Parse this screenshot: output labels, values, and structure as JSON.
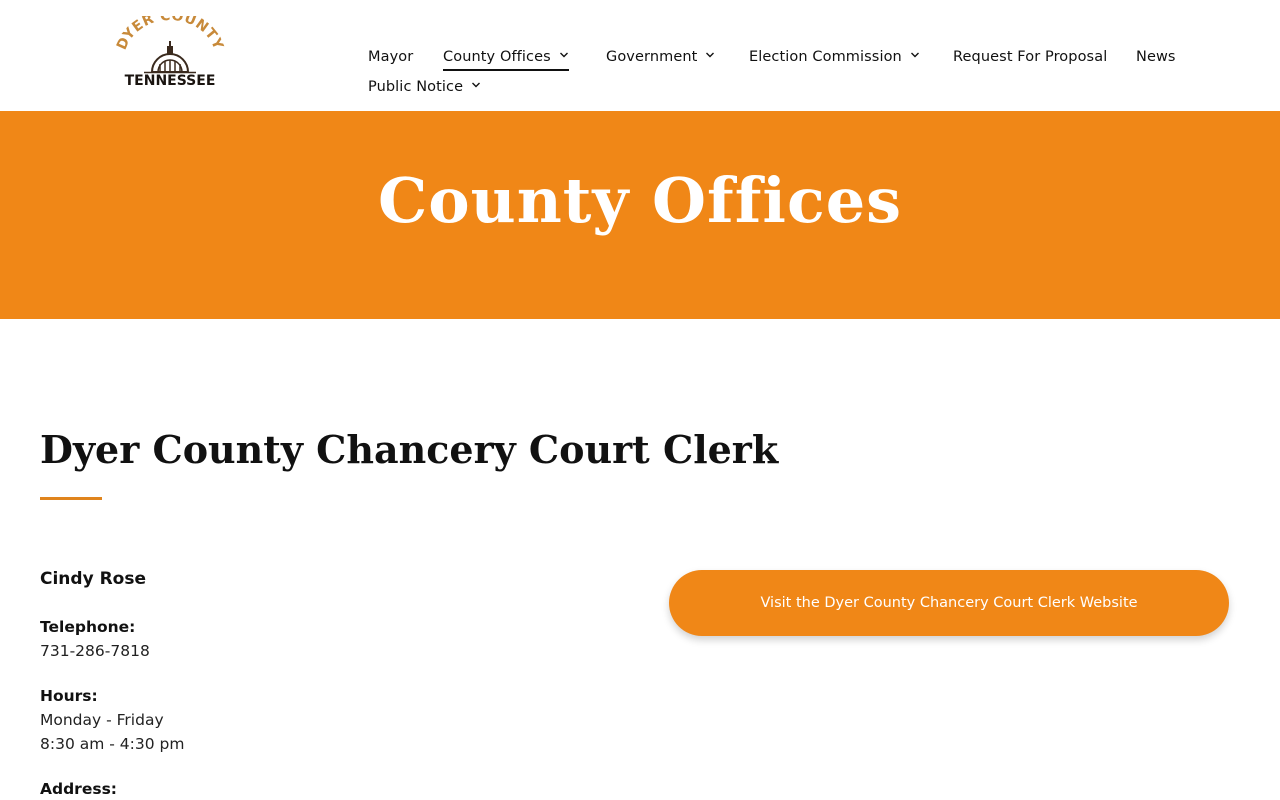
{
  "logo": {
    "arc_text": "DYER COUNTY",
    "sub_text": "TENNESSEE",
    "icon": "county-courthouse-logo"
  },
  "nav": {
    "items": [
      {
        "label": "Mayor",
        "has_dropdown": false
      },
      {
        "label": "County Offices",
        "has_dropdown": true,
        "active": true
      },
      {
        "label": "Government",
        "has_dropdown": true
      },
      {
        "label": "Election Commission",
        "has_dropdown": true
      },
      {
        "label": "Request For Proposal",
        "has_dropdown": false
      },
      {
        "label": "News",
        "has_dropdown": false
      },
      {
        "label": "Public Notice",
        "has_dropdown": true
      }
    ]
  },
  "banner": {
    "title": "County Offices"
  },
  "page": {
    "heading": "Dyer County Chancery Court Clerk"
  },
  "contact": {
    "name": "Cindy Rose",
    "telephone_label": "Telephone:",
    "telephone": "731-286-7818",
    "hours_label": "Hours:",
    "hours_days": "Monday - Friday",
    "hours_time": "8:30 am - 4:30 pm",
    "address_label": "Address:"
  },
  "cta": {
    "label": "Visit the Dyer County Chancery Court Clerk Website"
  },
  "colors": {
    "accent": "#f08717",
    "text": "#111111",
    "logo_brown": "#3a2a1e",
    "logo_gold": "#c88a3a"
  }
}
